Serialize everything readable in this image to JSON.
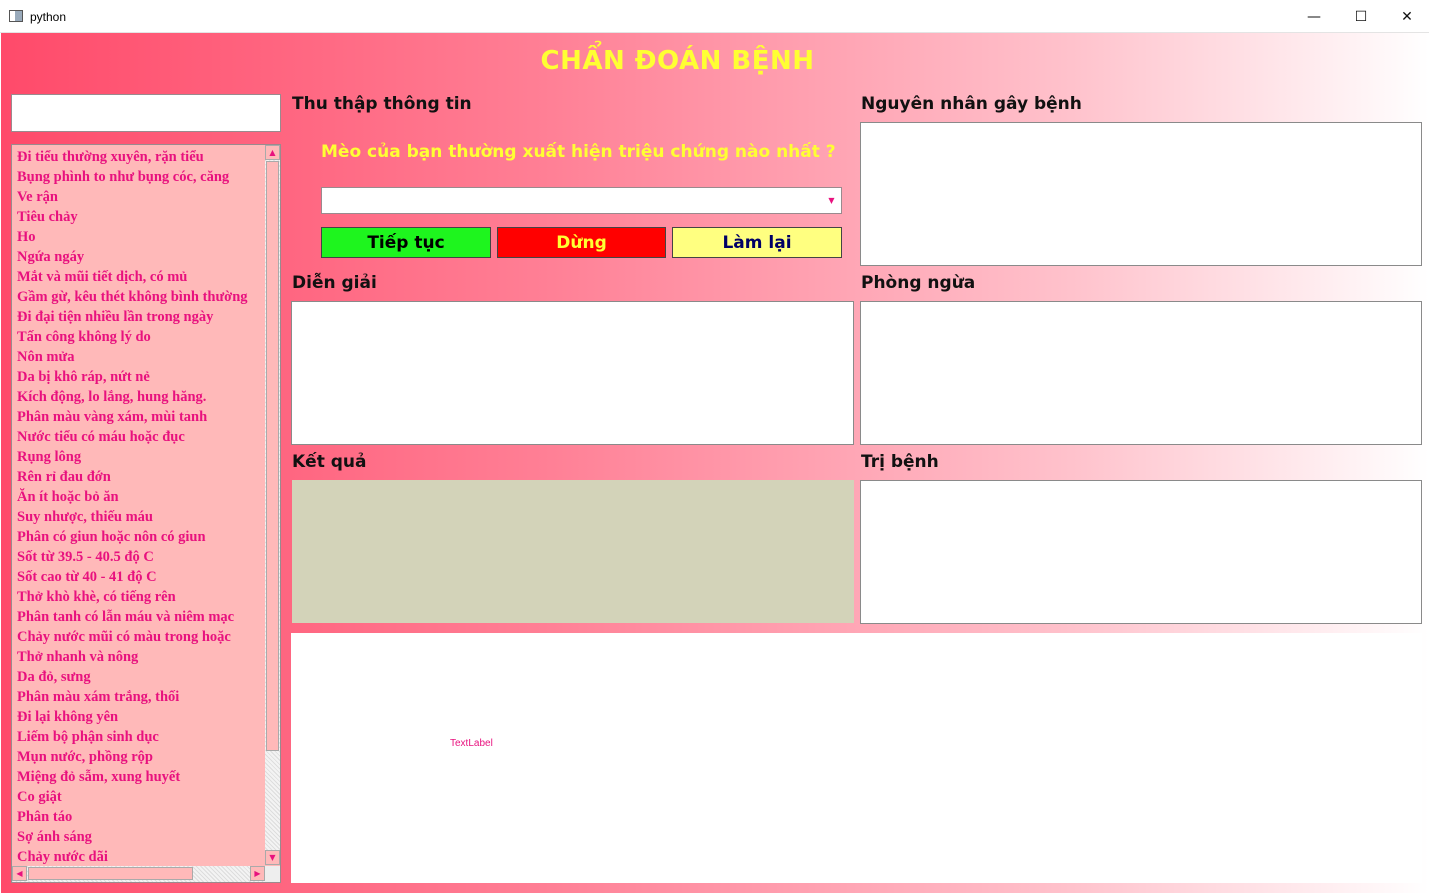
{
  "window": {
    "title": "python",
    "minimize_glyph": "—",
    "maximize_glyph": "☐",
    "close_glyph": "✕"
  },
  "app": {
    "title": "CHẨN ĐOÁN BỆNH",
    "title_color": "#ffff33",
    "accent_color": "#e8117e"
  },
  "symptom_search": {
    "value": ""
  },
  "symptoms": [
    "Đi tiểu thường xuyên, rặn tiểu",
    "Bụng phình to như bụng cóc, căng",
    "Ve rận",
    "Tiêu chảy",
    "Ho",
    "Ngứa ngáy",
    "Mắt và mũi tiết dịch, có mủ",
    "Gầm gừ, kêu thét không bình thường",
    "Đi đại tiện nhiều lần trong ngày",
    "Tấn công không lý do",
    "Nôn mửa",
    "Da bị khô ráp, nứt nẻ",
    "Kích động, lo lắng, hung hăng.",
    "Phân màu vàng xám, mùi tanh",
    "Nước tiểu có máu hoặc đục",
    "Rụng lông",
    "Rên rỉ đau đớn",
    "Ăn ít hoặc bỏ ăn",
    "Suy nhược, thiếu máu",
    "Phân có giun hoặc nôn có giun",
    "Sốt từ 39.5 - 40.5 độ C",
    "Sốt cao từ 40 - 41 độ C",
    "Thở khò khè, có tiếng rên",
    "Phân tanh có lẫn máu và niêm mạc",
    "Chảy nước mũi có màu trong hoặc",
    "Thở nhanh và nông",
    "Da đỏ, sưng",
    "Phân màu xám trắng, thối",
    "Đi lại không yên",
    "Liếm bộ phận sinh dục",
    "Mụn nước, phồng rộp",
    "Miệng đỏ sẫm, xung huyết",
    "Co giật",
    "Phân táo",
    "Sợ ánh sáng",
    "Chảy nước dãi"
  ],
  "scroll": {
    "up_glyph": "▲",
    "down_glyph": "▼",
    "left_glyph": "◀",
    "right_glyph": "▶"
  },
  "info": {
    "label": "Thu thập thông tin",
    "question": "Mèo của bạn thường xuất hiện triệu chứng nào nhất ?",
    "combo_value": "",
    "combo_arrow": "▼"
  },
  "buttons": {
    "continue": {
      "label": "Tiếp tục",
      "bg": "#1ef51e",
      "fg": "#000000"
    },
    "stop": {
      "label": "Dừng",
      "bg": "#ff0000",
      "fg": "#ffff33"
    },
    "reset": {
      "label": "Làm lại",
      "bg": "#ffff80",
      "fg": "#000066"
    }
  },
  "sections": {
    "cause": {
      "label": "Nguyên nhân gây bệnh",
      "content": ""
    },
    "explain": {
      "label": "Diễn giải",
      "content": ""
    },
    "prevention": {
      "label": "Phòng ngừa",
      "content": ""
    },
    "result": {
      "label": "Kết quả",
      "content": "",
      "bg": "#d3d3b9"
    },
    "treatment": {
      "label": "Trị bệnh",
      "content": ""
    }
  },
  "text_label": "TextLabel"
}
